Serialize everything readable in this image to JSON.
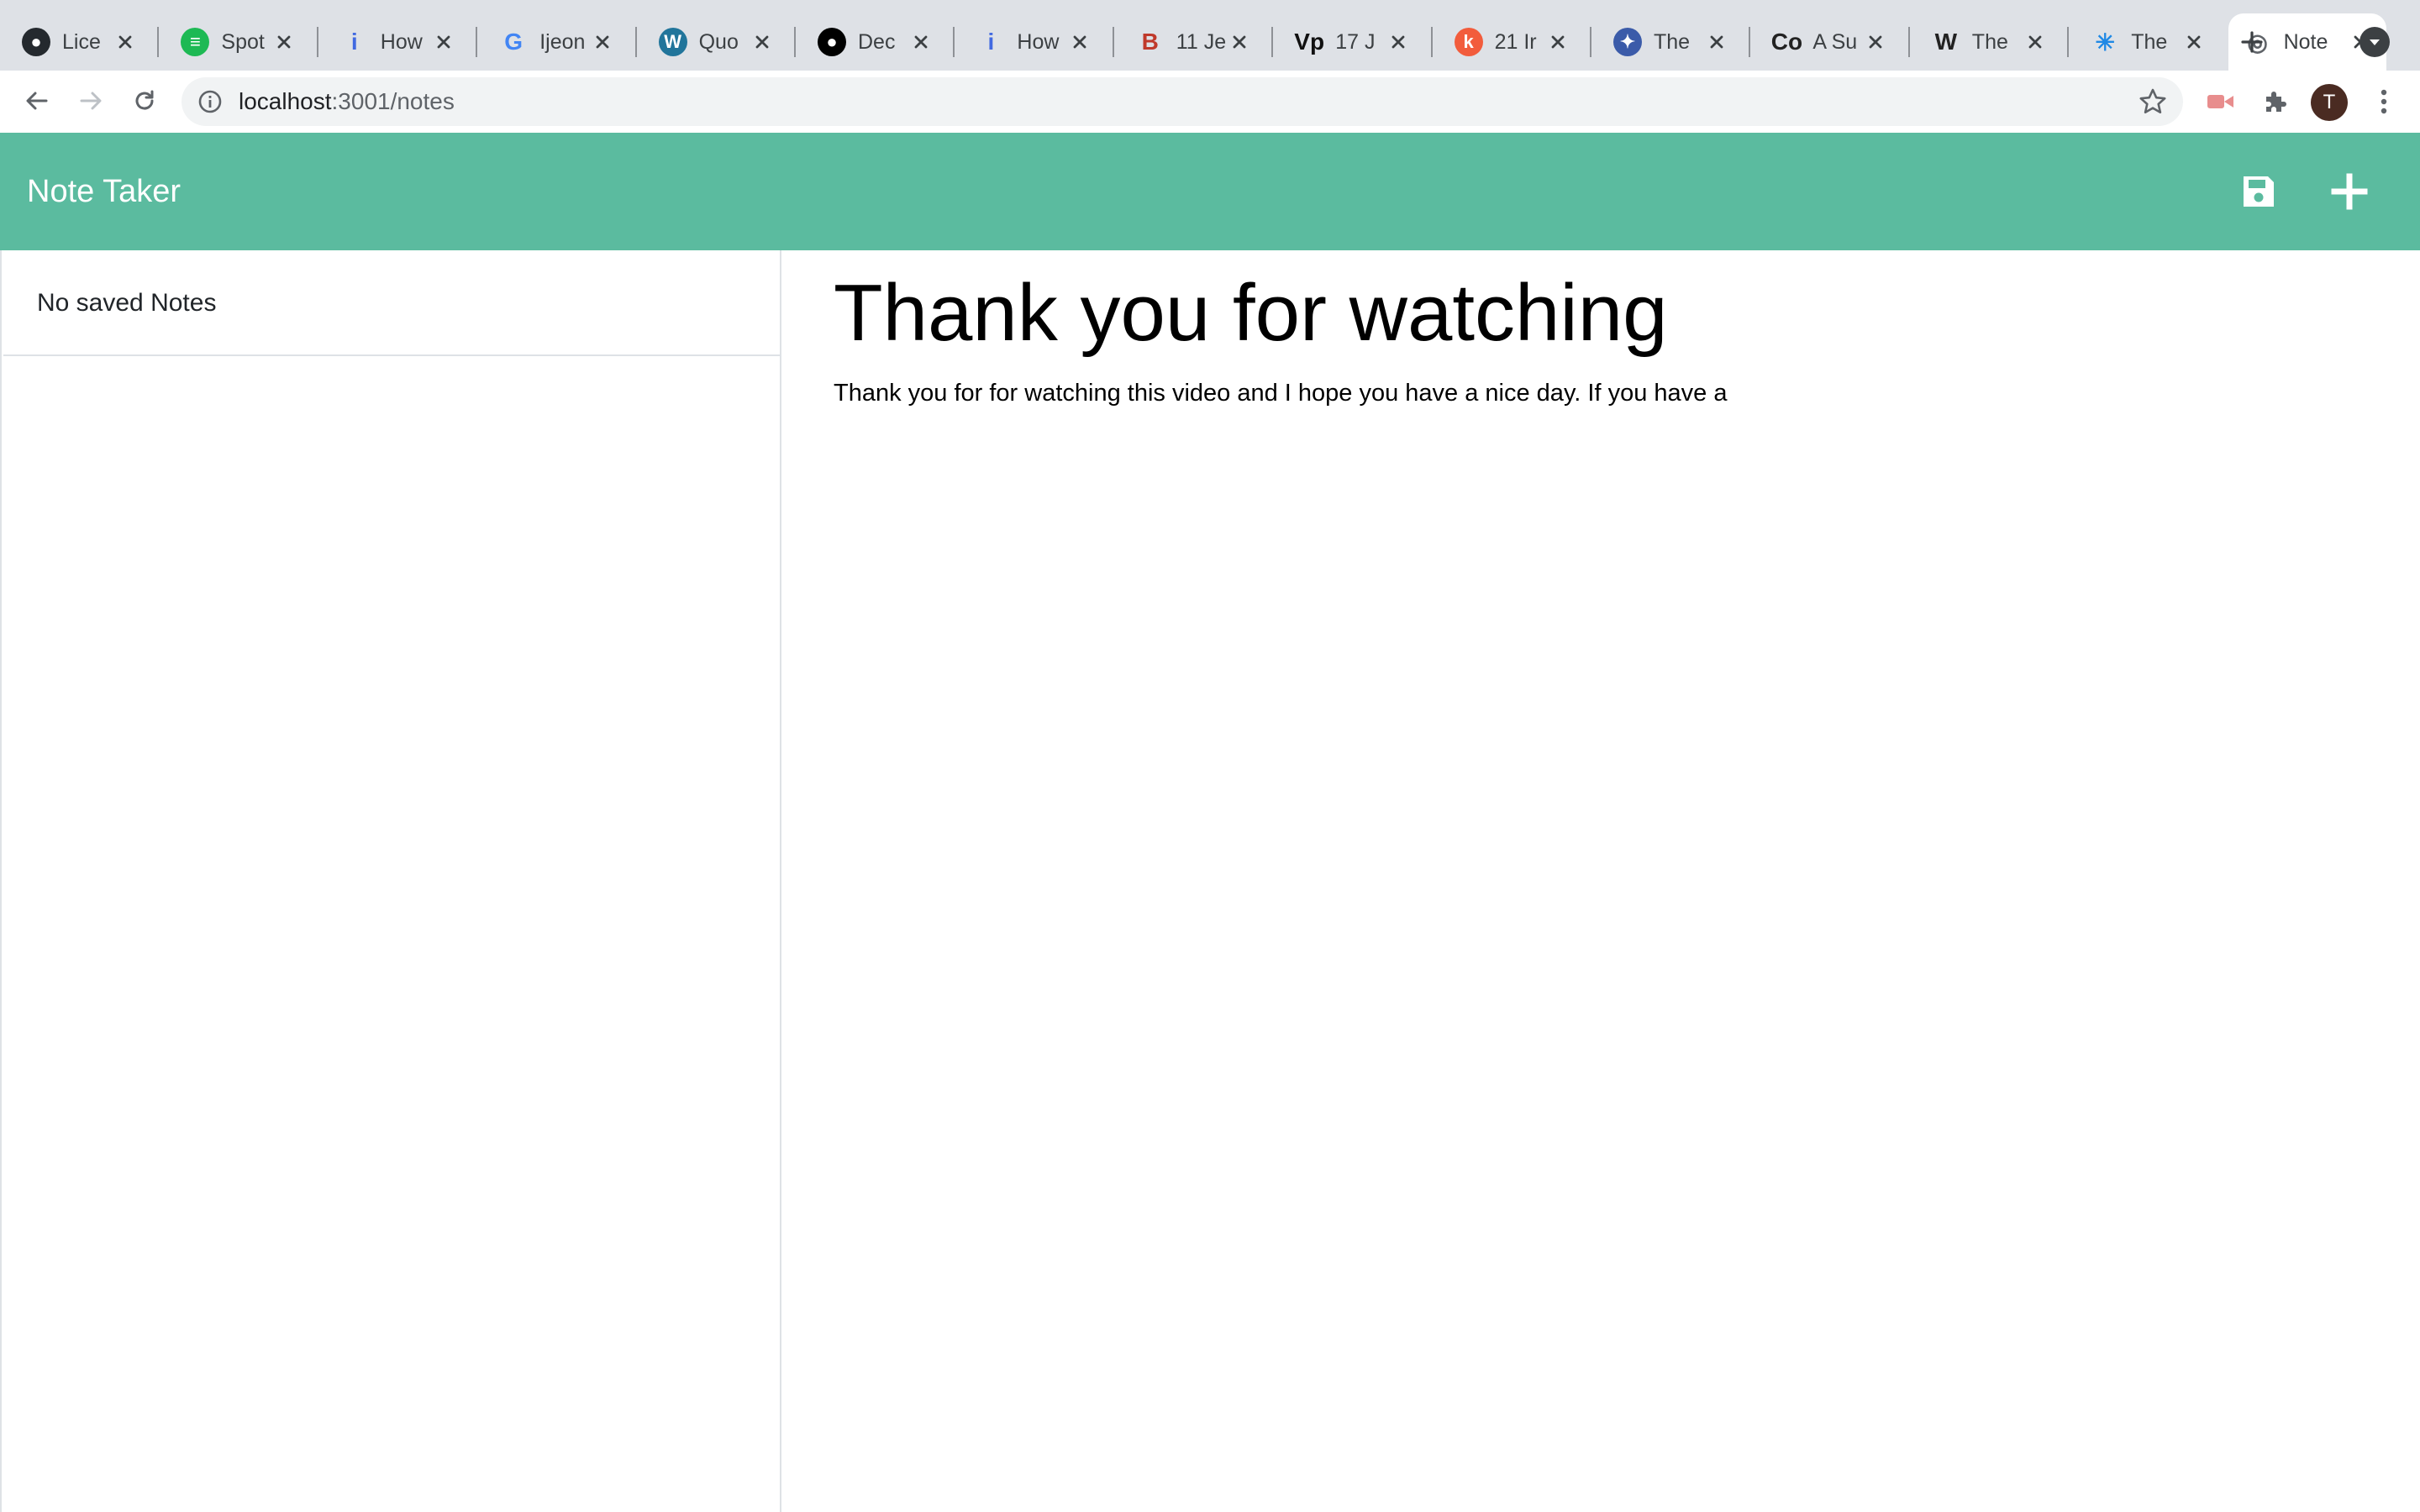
{
  "browser": {
    "tabs": [
      {
        "label": "Lice",
        "icon": "github-icon",
        "color": "#24292e",
        "active": false
      },
      {
        "label": "Spot",
        "icon": "spotify-icon",
        "color": "#1db954",
        "active": false
      },
      {
        "label": "How",
        "icon": "info-i-icon",
        "color": "#4169e1",
        "active": false
      },
      {
        "label": "Ijeon",
        "icon": "google-icon",
        "color": "#4285f4",
        "active": false
      },
      {
        "label": "Quo",
        "icon": "wordpress-icon",
        "color": "#21759b",
        "active": false
      },
      {
        "label": "Dec",
        "icon": "medium-icon",
        "color": "#000000",
        "active": false
      },
      {
        "label": "How",
        "icon": "info-i-icon",
        "color": "#4169e1",
        "active": false
      },
      {
        "label": "11 Je",
        "icon": "b-logo-icon",
        "color": "#c0392b",
        "active": false
      },
      {
        "label": "17 J",
        "icon": "vp-logo-icon",
        "color": "#111111",
        "active": false
      },
      {
        "label": "21 Ir",
        "icon": "k-logo-icon",
        "color": "#f25c3c",
        "active": false
      },
      {
        "label": "The",
        "icon": "badge-icon",
        "color": "#3b5ba9",
        "active": false
      },
      {
        "label": "A Su",
        "icon": "co-logo-icon",
        "color": "#222222",
        "active": false
      },
      {
        "label": "The",
        "icon": "wikipedia-icon",
        "color": "#222222",
        "active": false
      },
      {
        "label": "The",
        "icon": "snowflake-icon",
        "color": "#1e88e5",
        "active": false
      },
      {
        "label": "Note",
        "icon": "globe-icon",
        "color": "#5f6368",
        "active": true
      }
    ],
    "url_host": "localhost",
    "url_rest": ":3001/notes",
    "avatar_letter": "T"
  },
  "app": {
    "brand": "Note Taker",
    "accent_color": "#5bbb9f",
    "save_icon": "save-icon",
    "new_icon": "plus-icon"
  },
  "sidebar": {
    "empty_message": "No saved Notes"
  },
  "note": {
    "title": "Thank you for watching",
    "text": "Thank you for for watching this video and I hope you have a nice day. If you have a"
  }
}
